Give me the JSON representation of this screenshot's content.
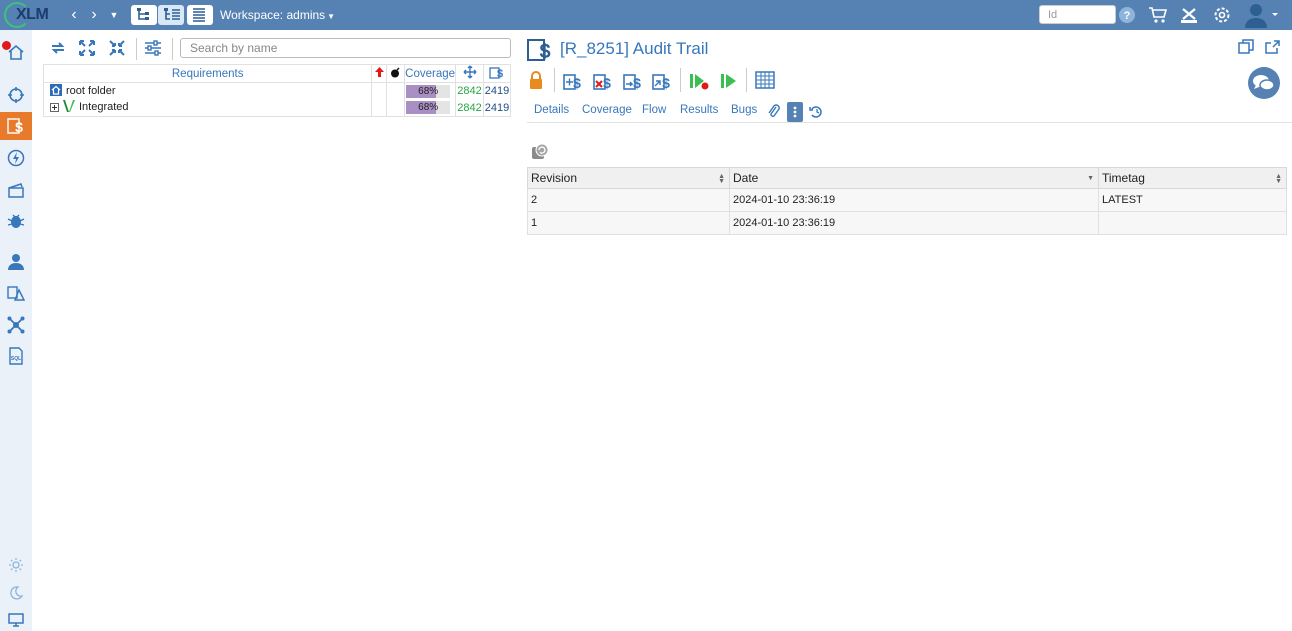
{
  "app": {
    "logo_text": "XLM"
  },
  "topbar": {
    "workspace_label": "Workspace: admins",
    "id_placeholder": "Id"
  },
  "tree": {
    "search_placeholder": "Search by name",
    "headers": {
      "requirements": "Requirements",
      "coverage": "Coverage"
    },
    "rows": [
      {
        "label": "root folder",
        "coverage_label": "68%",
        "coverage_fraction": 0.68,
        "count_green": "2842",
        "count_blue": "2419"
      },
      {
        "label": "Integrated",
        "coverage_label": "68%",
        "coverage_fraction": 0.68,
        "count_green": "2842",
        "count_blue": "2419"
      }
    ]
  },
  "detail": {
    "title": "[R_8251] Audit Trail",
    "tabs": [
      "Details",
      "Coverage",
      "Flow",
      "Results",
      "Bugs"
    ],
    "table": {
      "headers": [
        "Revision",
        "Date",
        "Timetag"
      ],
      "rows": [
        [
          "2",
          "2024-01-10 23:36:19",
          "LATEST"
        ],
        [
          "1",
          "2024-01-10 23:36:19",
          ""
        ]
      ]
    }
  },
  "colors": {
    "topbar": "#5582b3",
    "sidebar": "#eaf1f8",
    "active_nav": "#e87a2b",
    "link_blue": "#3777bc",
    "coverage_fill": "#a98fc4",
    "count_green": "#27a744"
  }
}
